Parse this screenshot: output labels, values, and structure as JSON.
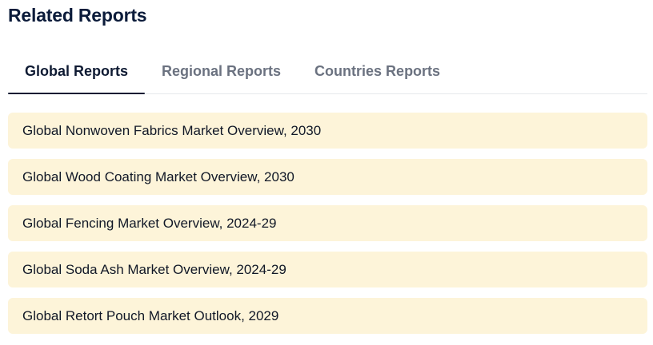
{
  "heading": "Related Reports",
  "tabs": [
    {
      "label": "Global Reports",
      "active": true
    },
    {
      "label": "Regional Reports",
      "active": false
    },
    {
      "label": "Countries Reports",
      "active": false
    }
  ],
  "reports": [
    {
      "title": "Global Nonwoven Fabrics Market Overview, 2030"
    },
    {
      "title": "Global Wood Coating Market Overview, 2030"
    },
    {
      "title": "Global Fencing Market Overview, 2024-29"
    },
    {
      "title": "Global Soda Ash Market Overview, 2024-29"
    },
    {
      "title": "Global Retort Pouch Market Outlook, 2029"
    }
  ],
  "colors": {
    "heading": "#0b1b3a",
    "active_tab": "#0f1b33",
    "inactive_tab": "#6b7280",
    "item_background": "#fdf4d9"
  }
}
